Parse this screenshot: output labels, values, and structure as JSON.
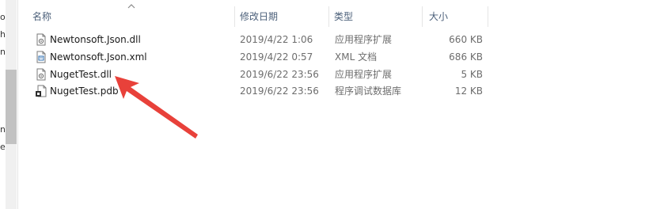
{
  "nav_pane": {
    "fragments": [
      "o",
      "h",
      "n",
      "n",
      "e"
    ]
  },
  "columns": {
    "name": "名称",
    "date": "修改日期",
    "type": "类型",
    "size": "大小"
  },
  "files": [
    {
      "name": "Newtonsoft.Json.dll",
      "date": "2019/4/22 1:06",
      "type": "应用程序扩展",
      "size": "660 KB",
      "icon": "dll-file-icon"
    },
    {
      "name": "Newtonsoft.Json.xml",
      "date": "2019/4/22 0:57",
      "type": "XML 文档",
      "size": "686 KB",
      "icon": "xml-file-icon"
    },
    {
      "name": "NugetTest.dll",
      "date": "2019/6/22 23:56",
      "type": "应用程序扩展",
      "size": "5 KB",
      "icon": "dll-file-icon"
    },
    {
      "name": "NugetTest.pdb",
      "date": "2019/6/22 23:56",
      "type": "程序调试数据库",
      "size": "12 KB",
      "icon": "pdb-file-icon"
    }
  ],
  "colors": {
    "header_text": "#4c607a",
    "meta_text": "#6d6d6d",
    "arrow": "#e8413a"
  }
}
